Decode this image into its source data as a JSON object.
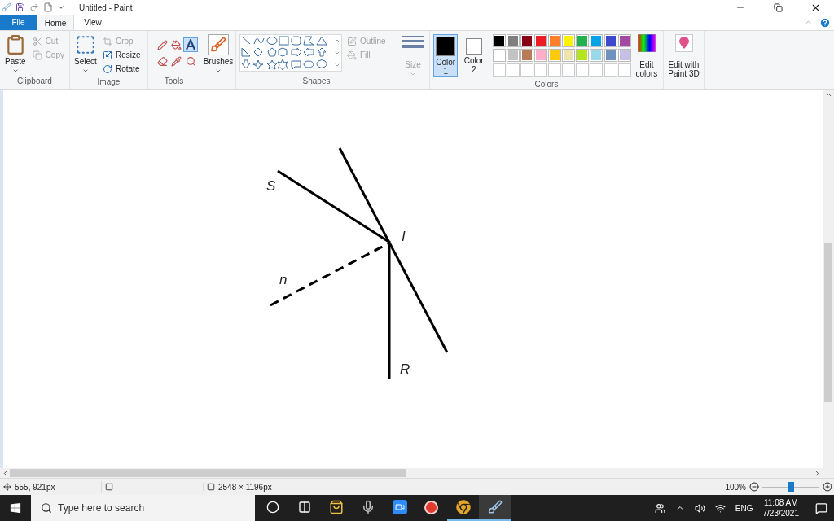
{
  "title_bar": {
    "title": "Untitled - Paint"
  },
  "tabs": [
    {
      "label": "File",
      "kind": "file",
      "selected": false
    },
    {
      "label": "Home",
      "kind": "tab",
      "selected": true
    },
    {
      "label": "View",
      "kind": "tab",
      "selected": false
    }
  ],
  "ribbon": {
    "clipboard": {
      "label": "Clipboard",
      "paste": "Paste",
      "items": [
        {
          "label": "Cut",
          "kind": "cut",
          "disabled": true
        },
        {
          "label": "Copy",
          "kind": "copy",
          "disabled": true
        }
      ]
    },
    "image": {
      "label": "Image",
      "select": "Select",
      "items": [
        {
          "label": "Crop",
          "kind": "crop",
          "disabled": true
        },
        {
          "label": "Resize",
          "kind": "resize",
          "disabled": false
        },
        {
          "label": "Rotate",
          "kind": "rotate",
          "disabled": false
        }
      ]
    },
    "tools": {
      "label": "Tools",
      "items": [
        {
          "kind": "pencil",
          "selected": false
        },
        {
          "kind": "fill",
          "selected": false
        },
        {
          "kind": "text",
          "selected": true
        },
        {
          "kind": "eraser",
          "selected": false
        },
        {
          "kind": "picker",
          "selected": false
        },
        {
          "kind": "magnifier",
          "selected": false
        }
      ]
    },
    "brushes": {
      "label": "Brushes"
    },
    "shapes": {
      "label": "Shapes",
      "options": [
        {
          "label": "Outline",
          "kind": "outline",
          "disabled": true
        },
        {
          "label": "Fill",
          "kind": "fill",
          "disabled": true
        }
      ]
    },
    "size": {
      "label": "Size",
      "disabled": true
    },
    "color_picks": [
      {
        "label": "Color",
        "number": "1",
        "color": "#000000",
        "selected": true
      },
      {
        "label": "Color",
        "number": "2",
        "color": "#ffffff",
        "selected": false
      }
    ],
    "palette": [
      {
        "color": "#000000"
      },
      {
        "color": "#7f7f7f"
      },
      {
        "color": "#880015"
      },
      {
        "color": "#ed1c24"
      },
      {
        "color": "#ff7f27"
      },
      {
        "color": "#fff200"
      },
      {
        "color": "#22b14c"
      },
      {
        "color": "#00a2e8"
      },
      {
        "color": "#3f48cc"
      },
      {
        "color": "#a349a4"
      },
      {
        "color": "#ffffff"
      },
      {
        "color": "#c3c3c3"
      },
      {
        "color": "#b97a57"
      },
      {
        "color": "#ffaec9"
      },
      {
        "color": "#ffc90e"
      },
      {
        "color": "#efe4b0"
      },
      {
        "color": "#b5e61d"
      },
      {
        "color": "#99d9ea"
      },
      {
        "color": "#7092be"
      },
      {
        "color": "#c8bfe7"
      }
    ],
    "edit_colors": {
      "line1": "Edit",
      "line2": "colors"
    },
    "colors_label": "Colors",
    "paint3d": {
      "line1": "Edit with",
      "line2": "Paint 3D"
    }
  },
  "canvas": {
    "labels": [
      "S",
      "I",
      "n",
      "R"
    ]
  },
  "status_bar": {
    "cursor": "555, 921px",
    "image_size": "2548 × 1196px",
    "zoom": "100%",
    "zoom_level": {
      "level": 0.5
    }
  },
  "taskbar": {
    "search": {
      "placeholder": "Type here to search"
    },
    "apps": [
      {
        "kind": "cortana",
        "selected": false,
        "running": false
      },
      {
        "kind": "task-view",
        "selected": false,
        "running": false
      },
      {
        "kind": "store",
        "selected": false,
        "running": false
      },
      {
        "kind": "microphone",
        "selected": false,
        "running": false
      },
      {
        "kind": "video",
        "selected": false,
        "running": false
      },
      {
        "kind": "red-app",
        "selected": false,
        "running": false
      },
      {
        "kind": "browser",
        "selected": false,
        "running": true
      },
      {
        "kind": "paint",
        "selected": true,
        "running": true
      }
    ],
    "language": "ENG",
    "time": "11:08 AM",
    "date": "7/23/2021"
  }
}
